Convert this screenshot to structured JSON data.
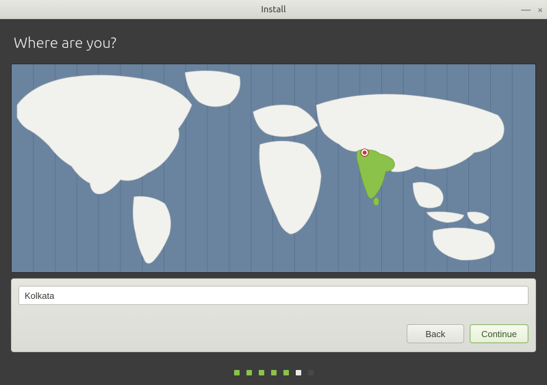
{
  "window": {
    "title": "Install"
  },
  "header": {
    "title": "Where are you?"
  },
  "timezone": {
    "value": "Kolkata"
  },
  "buttons": {
    "back": "Back",
    "continue": "Continue"
  },
  "progress": {
    "total": 7,
    "states": [
      "active",
      "active",
      "active",
      "active",
      "active",
      "current",
      "off"
    ]
  },
  "map": {
    "highlighted_region": "India",
    "pin": {
      "x_pct": 67.3,
      "y_pct": 42.5
    }
  }
}
